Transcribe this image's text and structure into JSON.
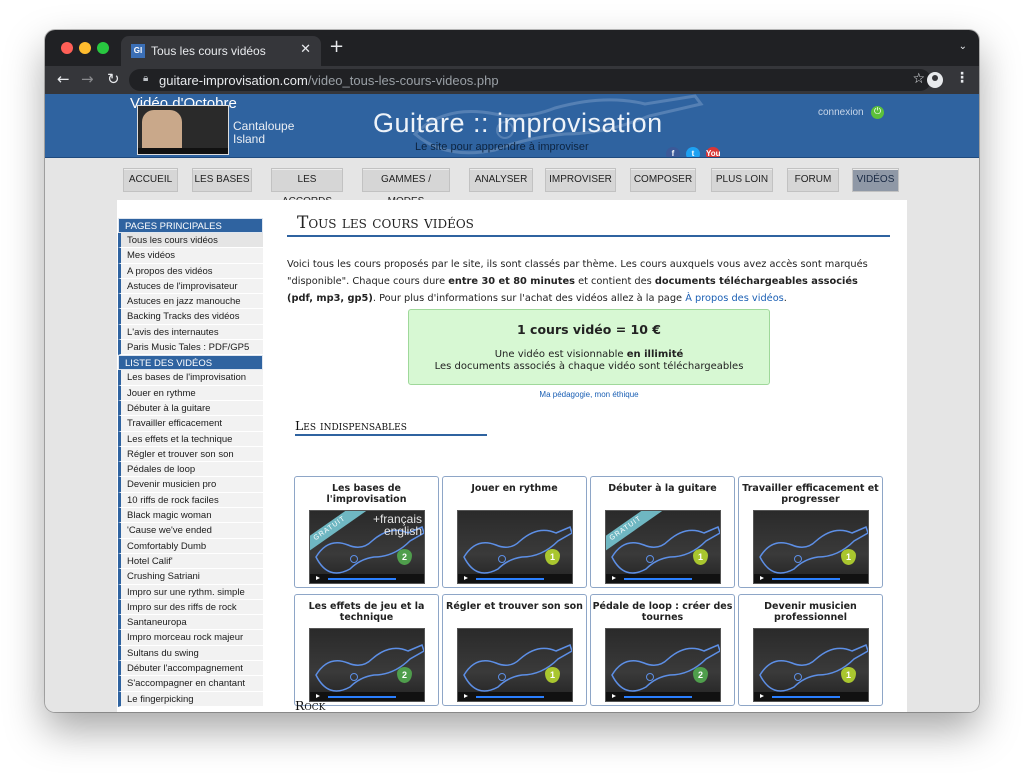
{
  "browser": {
    "tab_title": "Tous les cours vidéos",
    "favicon_text": "GI",
    "url_domain": "guitare-improvisation.com",
    "url_path": "/video_tous-les-cours-videos.php"
  },
  "header": {
    "month_title": "Vidéo d'Octobre",
    "month_song_line1": "Cantaloupe",
    "month_song_line2": "Island",
    "site_title": "Guitare :: improvisation",
    "site_subtitle": "Le site pour apprendre à improviser",
    "connexion": "connexion",
    "social_fb": "f",
    "social_tw": "t",
    "social_yt": "You"
  },
  "nav": {
    "items": [
      "ACCUEIL",
      "LES BASES",
      "LES ACCORDS",
      "GAMMES / MODES",
      "ANALYSER",
      "IMPROVISER",
      "COMPOSER",
      "PLUS LOIN",
      "FORUM",
      "VIDÉOS"
    ]
  },
  "sidebar": {
    "section1": "PAGES PRINCIPALES",
    "pages": [
      "Tous les cours vidéos",
      "Mes vidéos",
      "A propos des vidéos",
      "Astuces de l'improvisateur",
      "Astuces en jazz manouche",
      "Backing Tracks des vidéos",
      "L'avis des internautes",
      "Paris Music Tales : PDF/GP5"
    ],
    "section2": "LISTE DES VIDÉOS",
    "videos": [
      "Les bases de l'improvisation",
      "Jouer en rythme",
      "Débuter à la guitare",
      "Travailler efficacement",
      "Les effets et la technique",
      "Régler et trouver son son",
      "Pédales de loop",
      "Devenir musicien pro",
      "10 riffs de rock faciles",
      "Black magic woman",
      "'Cause we've ended",
      "Comfortably Dumb",
      "Hotel Calif'",
      "Crushing Satriani",
      "Impro sur une rythm. simple",
      "Impro sur des riffs de rock",
      "Santaneuropa",
      "Impro morceau rock majeur",
      "Sultans du swing",
      "Débuter l'accompagnement",
      "S'accompagner en chantant",
      "Le fingerpicking"
    ]
  },
  "main": {
    "title": "Tous les cours vidéos",
    "intro_1": "Voici tous les cours proposés par le site, ils sont classés par thème. Les cours auxquels vous avez accès sont marqués \"disponible\". Chaque cours dure ",
    "intro_b1": "entre 30 et 80 minutes",
    "intro_2": " et contient des ",
    "intro_b2": "documents téléchargeables associés (pdf, mp3, gp5)",
    "intro_3": ". Pour plus d'informations sur l'achat des vidéos allez à la page ",
    "intro_link": "À propos des vidéos",
    "intro_4": ".",
    "price_title": "1 cours vidéo = 10 €",
    "price_line1a": "Une vidéo est visionnable ",
    "price_line1b": "en illimité",
    "price_line2": "Les documents associés à chaque vidéo sont téléchargeables",
    "ethics_link": "Ma pédagogie, mon éthique",
    "section1": "Les indispensables",
    "section2": "Rock",
    "free_label": "GRATUIT",
    "lang_fr": "+français",
    "lang_en": "english",
    "cards": [
      {
        "title": "Les bases de l'improvisation",
        "level": "2",
        "free": true,
        "lang": true
      },
      {
        "title": "Jouer en rythme",
        "level": "1",
        "free": false,
        "lang": false
      },
      {
        "title": "Débuter à la guitare",
        "level": "1",
        "free": true,
        "lang": false
      },
      {
        "title": "Travailler efficacement et progresser",
        "level": "1",
        "free": false,
        "lang": false
      },
      {
        "title": "Les effets de jeu et la technique",
        "level": "2",
        "free": false,
        "lang": false
      },
      {
        "title": "Régler et trouver son son",
        "level": "1",
        "free": false,
        "lang": false
      },
      {
        "title": "Pédale de loop : créer des tournes",
        "level": "2",
        "free": false,
        "lang": false
      },
      {
        "title": "Devenir musicien professionnel",
        "level": "1",
        "free": false,
        "lang": false
      }
    ]
  },
  "colors": {
    "header_blue": "#2f63a0",
    "price_green": "#d7f8d3",
    "level1": "#a9c62f",
    "level2": "#4f9e4c"
  }
}
